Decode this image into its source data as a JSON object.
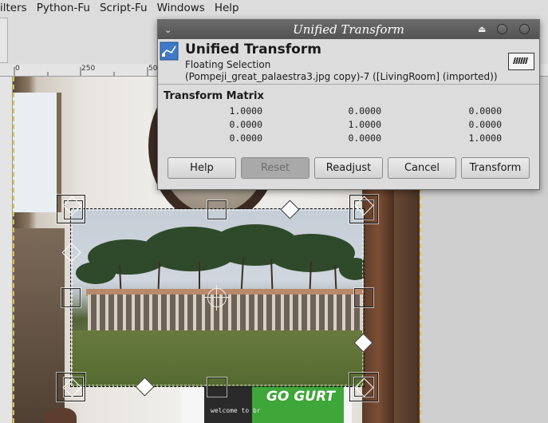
{
  "menubar": {
    "items": [
      "ilters",
      "Python-Fu",
      "Script-Fu",
      "Windows",
      "Help"
    ]
  },
  "ruler": {
    "top_labels": [
      "0",
      "250",
      "50"
    ]
  },
  "canvas": {
    "poster_brand": "GO GURT",
    "poster_tagline": "welcome to br"
  },
  "dialog": {
    "title": "Unified Transform",
    "tool_name": "Unified Transform",
    "layer_type": "Floating Selection",
    "layer_info": "(Pompeji_great_palaestra3.jpg copy)-7 ([LivingRoom] (imported))",
    "matrix_label": "Transform Matrix",
    "matrix": [
      [
        "1.0000",
        "0.0000",
        "0.0000"
      ],
      [
        "0.0000",
        "1.0000",
        "0.0000"
      ],
      [
        "0.0000",
        "0.0000",
        "1.0000"
      ]
    ],
    "buttons": {
      "help": "Help",
      "reset": "Reset",
      "readjust": "Readjust",
      "cancel": "Cancel",
      "transform": "Transform"
    },
    "icons": {
      "menu": "chevron-down-icon",
      "shade": "eject-icon",
      "tool": "unified-transform-icon",
      "preset": "keyboard-icon"
    }
  }
}
